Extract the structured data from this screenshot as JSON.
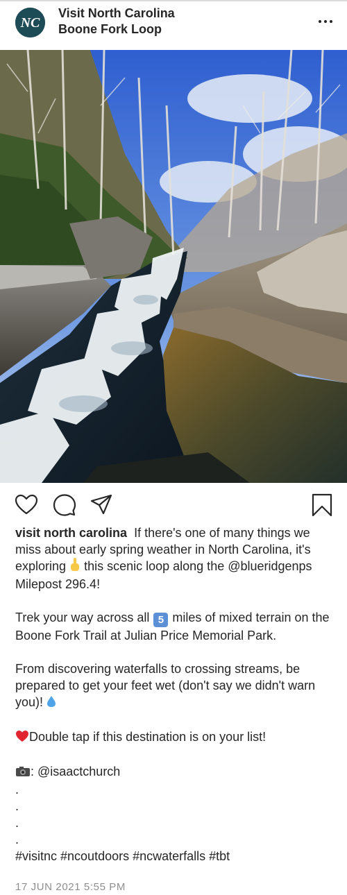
{
  "post": {
    "account_name": "Visit North Carolina",
    "location": "Boone Fork Loop",
    "avatar_text": "NC",
    "more_icon": "more-horizontal-icon",
    "photo_description": "Boone Fork creek cascading over rocks under a blue sky",
    "actions": {
      "like_icon": "heart-icon",
      "comment_icon": "comment-icon",
      "share_icon": "send-icon",
      "save_icon": "bookmark-icon"
    },
    "caption": {
      "username": "visit north carolina",
      "p1_a": "If there's one of many things we miss about early spring weather in North Carolina, it's  exploring",
      "p1_b": "this scenic loop along the @blueridgenps Milepost 296.4!",
      "p2_a": "Trek your way across all",
      "p2_keycap": "5",
      "p2_b": "miles of mixed terrain on the Boone Fork Trail at Julian Price Memorial Park.",
      "p3": "From discovering waterfalls to crossing streams, be prepared to get your feet wet (don't say we didn't warn you)!",
      "p4": "Double tap if this destination is on your list!",
      "p5": ": @isaactchurch",
      "dots": [
        ".",
        ".",
        ".",
        "."
      ],
      "hashtags": "#visitnc #ncoutdoors #ncwaterfalls #tbt"
    },
    "timestamp": "17 JUN 2021 5:55 PM"
  }
}
